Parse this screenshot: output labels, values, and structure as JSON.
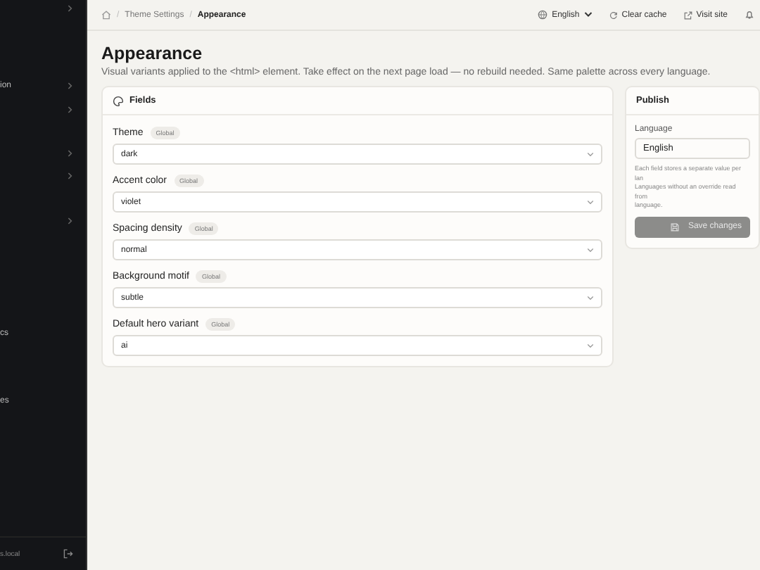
{
  "sidebar": {
    "items": [
      {
        "chevron": true
      },
      {
        "label": "ion",
        "chevron": true
      },
      {
        "chevron": true
      },
      {
        "chevron": true
      },
      {
        "chevron": true
      },
      {
        "chevron": true
      },
      {
        "label": "cs",
        "chevron": false
      },
      {
        "label": "es",
        "chevron": false
      }
    ],
    "footer": "s.local"
  },
  "breadcrumbs": [
    {
      "separator": "/",
      "label": "Theme Settings"
    },
    {
      "separator": "/",
      "label": "Appearance"
    }
  ],
  "topbar": {
    "language": "English",
    "clear_cache": "Clear cache",
    "visit_site": "Visit site"
  },
  "page": {
    "title": "Appearance",
    "description": "Visual variants applied to the <html> element. Take effect on the next page load — no rebuild needed. Same palette across every language."
  },
  "fields_card": {
    "title": "Fields",
    "fields": [
      {
        "label": "Theme",
        "badge": "Global",
        "value": "dark"
      },
      {
        "label": "Accent color",
        "badge": "Global",
        "value": "violet"
      },
      {
        "label": "Spacing density",
        "badge": "Global",
        "value": "normal"
      },
      {
        "label": "Background motif",
        "badge": "Global",
        "value": "subtle"
      },
      {
        "label": "Default hero variant",
        "badge": "Global",
        "value": "ai"
      }
    ]
  },
  "publish": {
    "title": "Publish",
    "language_label": "Language",
    "language_value": "English",
    "hint": [
      "Each field stores a separate value per lan",
      "Languages without an override read from",
      "language."
    ],
    "save": {
      "label": "Save changes",
      "disabled": true
    }
  }
}
